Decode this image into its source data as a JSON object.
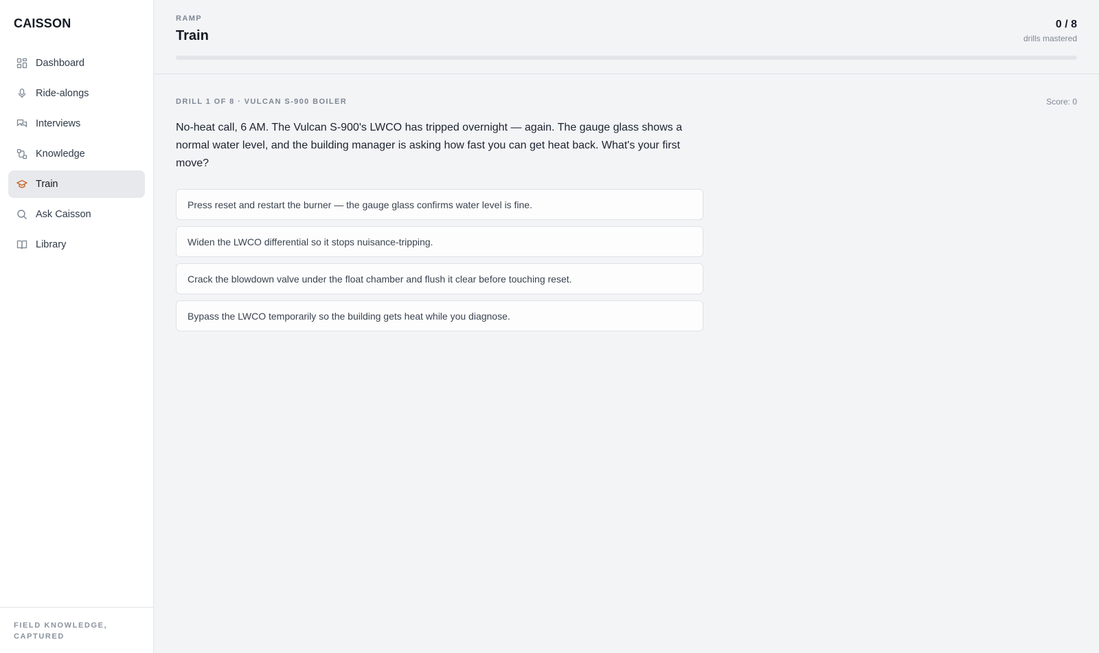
{
  "app": {
    "brand": "CAISSON",
    "tagline": "FIELD KNOWLEDGE, CAPTURED"
  },
  "sidebar": {
    "items": [
      {
        "label": "Dashboard",
        "icon": "grid-icon"
      },
      {
        "label": "Ride-alongs",
        "icon": "microphone-icon"
      },
      {
        "label": "Interviews",
        "icon": "chat-bubbles-icon"
      },
      {
        "label": "Knowledge",
        "icon": "nodes-icon"
      },
      {
        "label": "Train",
        "icon": "graduation-cap-icon",
        "active": true
      },
      {
        "label": "Ask Caisson",
        "icon": "search-icon"
      },
      {
        "label": "Library",
        "icon": "book-icon"
      }
    ]
  },
  "header": {
    "eyebrow": "RAMP",
    "title": "Train",
    "mastered_count": "0 / 8",
    "mastered_label": "drills mastered",
    "progress_fraction": 0
  },
  "drill": {
    "meta": "DRILL 1 OF 8 · VULCAN S-900 BOILER",
    "score": "Score: 0",
    "question": "No-heat call, 6 AM. The Vulcan S-900's LWCO has tripped overnight — again. The gauge glass shows a normal water level, and the building manager is asking how fast you can get heat back. What's your first move?",
    "options": [
      "Press reset and restart the burner — the gauge glass confirms water level is fine.",
      "Widen the LWCO differential so it stops nuisance-tripping.",
      "Crack the blowdown valve under the float chamber and flush it clear before touching reset.",
      "Bypass the LWCO temporarily so the building gets heat while you diagnose."
    ]
  },
  "colors": {
    "accent": "#c8642a",
    "active_bg": "#e8e9ec",
    "page_bg": "#f3f4f6"
  }
}
